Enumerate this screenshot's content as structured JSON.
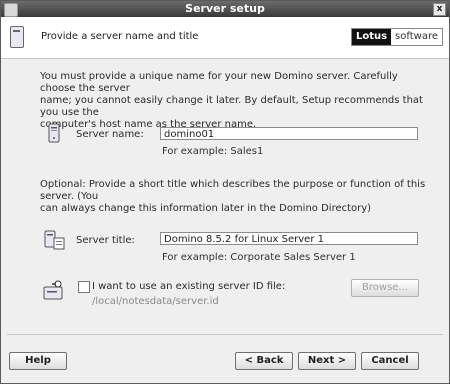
{
  "window": {
    "title": "Server setup",
    "close_label": "x"
  },
  "header": {
    "subtitle": "Provide a server name and title",
    "brand_part1": "Lotus",
    "brand_part2": "software"
  },
  "intro": {
    "line1": "You must provide a unique name for your new Domino server. Carefully choose the server",
    "line2": "name; you cannot easily change it later. By default, Setup recommends that you use the",
    "line3": "computer's host name as the server name."
  },
  "server_name": {
    "label": "Server name:",
    "value": "domino01",
    "example": "For example: Sales1"
  },
  "optional": {
    "line1": "Optional: Provide a short title which describes the purpose or function of this server. (You",
    "line2": "can always change this information later in the Domino Directory)"
  },
  "server_title": {
    "label": "Server title:",
    "value": "Domino 8.5.2 for Linux Server 1",
    "example": "For example: Corporate Sales Server 1"
  },
  "existing_id": {
    "checkbox_label": "I want to use an existing server ID file:",
    "path": "/local/notesdata/server.id",
    "browse_label": "Browse..."
  },
  "buttons": {
    "help": "Help",
    "back": "< Back",
    "next": "Next >",
    "cancel": "Cancel"
  },
  "icons": {
    "header": "server-tower-icon",
    "server_name": "server-tower-icon",
    "server_title": "server-document-icon",
    "existing_id": "server-key-icon"
  }
}
